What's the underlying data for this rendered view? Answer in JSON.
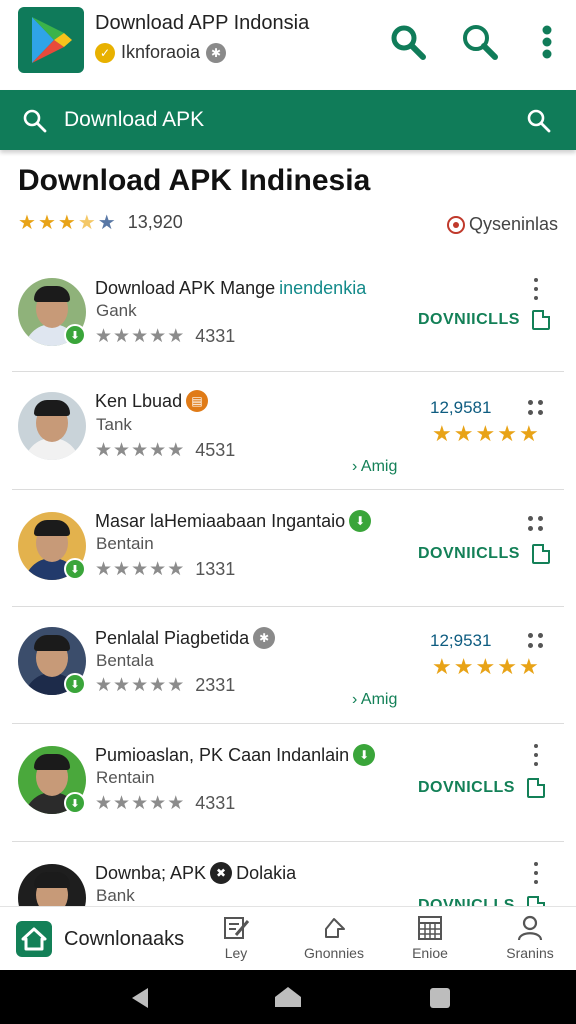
{
  "header": {
    "app_title": "Download APP Indonsia",
    "app_subtitle": "Iknforaoia",
    "icons": [
      "play-logo-icon",
      "search-icon",
      "search-icon",
      "more-vert-icon"
    ]
  },
  "search": {
    "placeholder": "Download APK"
  },
  "page": {
    "title": "Download APK Indinesia",
    "rating_count": "13,920",
    "rating_stars": 3.5,
    "filter_label": "Qyseninlas"
  },
  "items": [
    {
      "title": "Download APK Mange",
      "title_highlight": "inendenkia",
      "subtitle": "Gank",
      "rating": "4331",
      "action": "DOVNIICLLS",
      "variant": "download"
    },
    {
      "title": "Ken Lbuad",
      "subtitle": "Tank",
      "rating": "4531",
      "count": "12,9581",
      "extra": "Amig",
      "variant": "stars"
    },
    {
      "title": "Masar laHemiaabaan Ingantaio",
      "subtitle": "Bentain",
      "rating": "1331",
      "action": "DOVNIICLLS",
      "variant": "download"
    },
    {
      "title": "Penlalal Piagbetida",
      "subtitle": "Bentala",
      "rating": "2331",
      "count": "12;9531",
      "extra": "Amig",
      "variant": "stars"
    },
    {
      "title": "Pumioaslan, PK Caan Indanlain",
      "subtitle": "Rentain",
      "rating": "4331",
      "action": "DOVNICLLS",
      "variant": "download"
    },
    {
      "title_a": "Downba; APK",
      "title_b": "Dolakia",
      "subtitle": "Bank",
      "action": "DOVNICLLS",
      "variant": "download"
    }
  ],
  "bottom_nav": {
    "home_label": "Cownlonaaks",
    "tabs": [
      "Ley",
      "Gnonnies",
      "Enioe",
      "Sranins"
    ]
  },
  "colors": {
    "brand_green": "#107c59",
    "star_gold": "#e8a317",
    "star_gray": "#8c8c8c"
  }
}
